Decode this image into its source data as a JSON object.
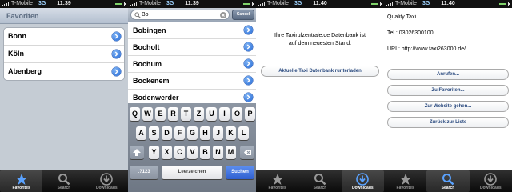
{
  "statusbars": [
    {
      "carrier": "T-Mobile",
      "network": "3G",
      "time": "11:39"
    },
    {
      "carrier": "T-Mobile",
      "network": "3G",
      "time": "11:39"
    },
    {
      "carrier": "T-Mobile",
      "network": "3G",
      "time": "11:40"
    },
    {
      "carrier": "T-Mobile",
      "network": "3G",
      "time": "11:40"
    }
  ],
  "tabs": {
    "favorites": "Favorites",
    "search": "Search",
    "downloads": "Downloads"
  },
  "favorites_screen": {
    "title": "Favoriten",
    "items": [
      "Bonn",
      "Köln",
      "Abenberg"
    ]
  },
  "search_screen": {
    "query": "Bo",
    "cancel_label": "Cancel",
    "results": [
      "Bobingen",
      "Bocholt",
      "Bochum",
      "Bockenem",
      "Bodenwerder"
    ],
    "keyboard": {
      "row1": [
        "Q",
        "W",
        "E",
        "R",
        "T",
        "Z",
        "U",
        "I",
        "O",
        "P"
      ],
      "row2": [
        "A",
        "S",
        "D",
        "F",
        "G",
        "H",
        "J",
        "K",
        "L"
      ],
      "row3": [
        "Y",
        "X",
        "C",
        "V",
        "B",
        "N",
        "M"
      ],
      "numbers_key": ".?123",
      "space_key": "Leerzeichen",
      "search_key": "Suchen"
    }
  },
  "database_screen": {
    "message_line1": "Ihre Taxirufzentrale.de Datenbank ist",
    "message_line2": "auf dem neuesten Stand.",
    "update_button": "Aktuelle Taxi Datenbank runterladen"
  },
  "detail_screen": {
    "name": "Quality Taxi",
    "phone": "Tel.: 03026300100",
    "url": "URL: http://www.taxi263000.de/",
    "call_button": "Anrufen...",
    "favorites_button": "Zu Favoriten...",
    "website_button": "Zur Website gehen...",
    "back_button": "Zurück zur Liste"
  },
  "colors": {
    "accent": "#2f5fd0",
    "navbar": "#b3bfcf",
    "tabbar": "#0a0a0a"
  }
}
